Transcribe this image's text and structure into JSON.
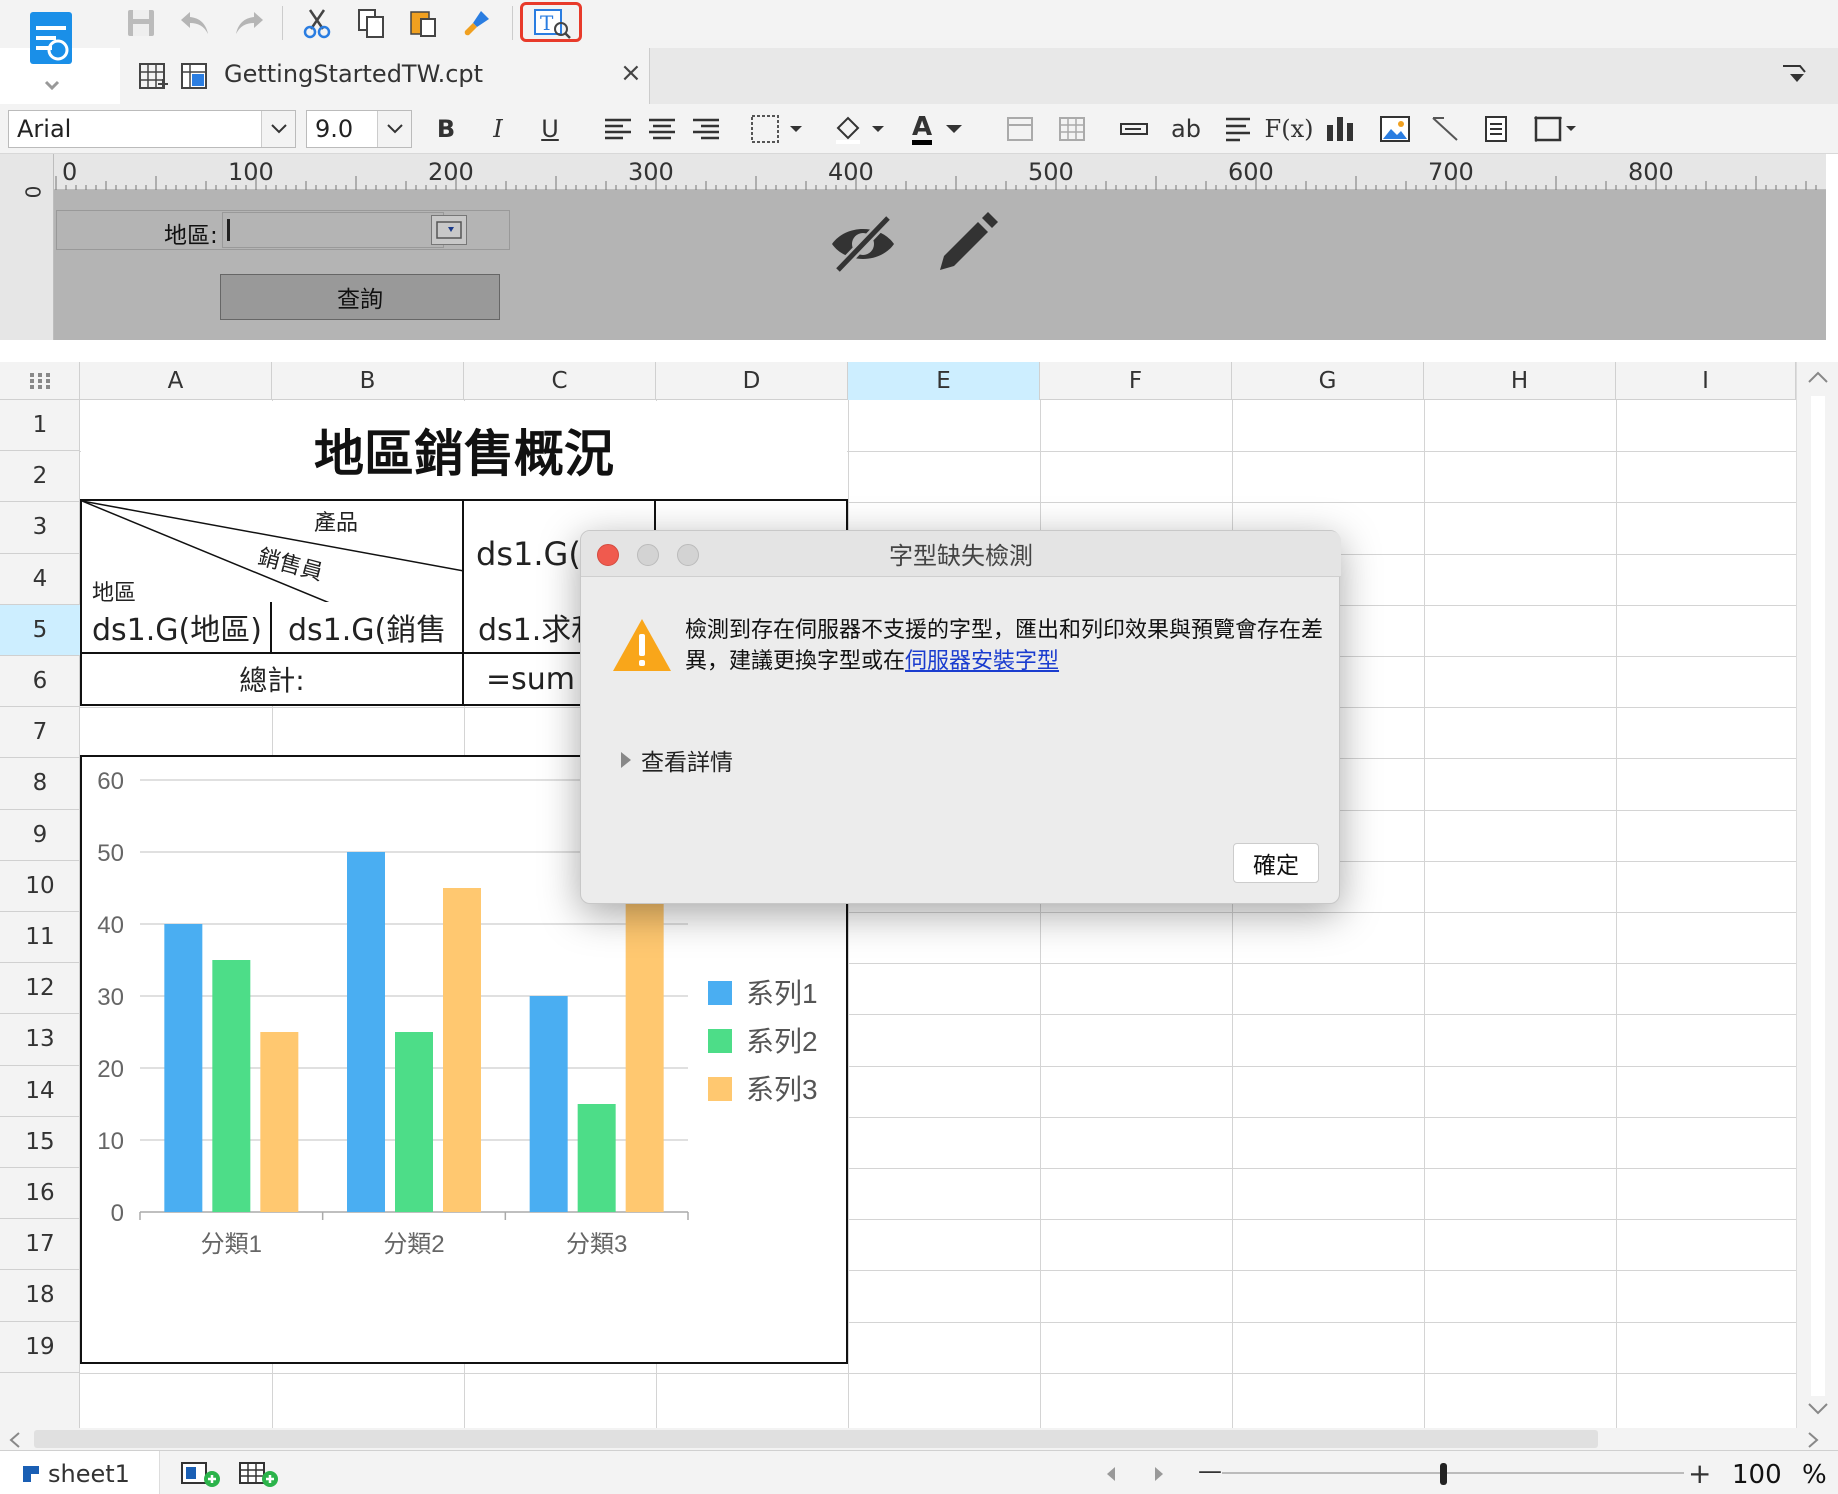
{
  "tab": {
    "filename": "GettingStartedTW.cpt",
    "close": "×"
  },
  "format_toolbar": {
    "font": "Arial",
    "size": "9.0",
    "bold": "B",
    "italic": "I",
    "underline": "U",
    "text_color_label": "A",
    "ab_label": "ab",
    "fx_label": "F(x)"
  },
  "ruler": {
    "marks": [
      "0",
      "100",
      "200",
      "300",
      "400",
      "500",
      "600",
      "700",
      "800"
    ],
    "vertical_mark": "0"
  },
  "param_panel": {
    "region_label": "地區:",
    "query_button": "查詢"
  },
  "sheet": {
    "columns": [
      "A",
      "B",
      "C",
      "D",
      "E",
      "F",
      "G",
      "H",
      "I"
    ],
    "selected_column": "E",
    "rows": [
      "1",
      "2",
      "3",
      "4",
      "5",
      "6",
      "7",
      "8",
      "9",
      "10",
      "11",
      "12",
      "13",
      "14",
      "15",
      "16",
      "17",
      "18",
      "19"
    ],
    "selected_row": "5",
    "title": "地區銷售概況",
    "diag_product": "產品",
    "diag_salesperson": "銷售員",
    "diag_region": "地區",
    "c3": "ds1.G(產",
    "a4": "ds1.G(地區)",
    "b4": "ds1.G(銷售",
    "c4": "ds1.求和",
    "total_label": "總計:",
    "c5": "=sum"
  },
  "chart_data": {
    "type": "bar",
    "categories": [
      "分類1",
      "分類2",
      "分類3"
    ],
    "series": [
      {
        "name": "系列1",
        "values": [
          40,
          50,
          30
        ],
        "color": "#4aaef2"
      },
      {
        "name": "系列2",
        "values": [
          35,
          25,
          15
        ],
        "color": "#4ddd88"
      },
      {
        "name": "系列3",
        "values": [
          25,
          45,
          55
        ],
        "color": "#ffc870"
      }
    ],
    "ylim": [
      0,
      60
    ],
    "yticks": [
      "0",
      "10",
      "20",
      "30",
      "40",
      "50",
      "60"
    ],
    "grid": true,
    "legend": "right"
  },
  "dialog": {
    "title": "字型缺失檢測",
    "message": "檢測到存在伺服器不支援的字型，匯出和列印效果與預覽會存在差異，建議更換字型或在",
    "link": "伺服器安裝字型",
    "details": "查看詳情",
    "ok": "確定"
  },
  "statusbar": {
    "sheet_tab": "sheet1",
    "zoom": "100",
    "percent": "%",
    "minus": "—",
    "plus": "+"
  }
}
